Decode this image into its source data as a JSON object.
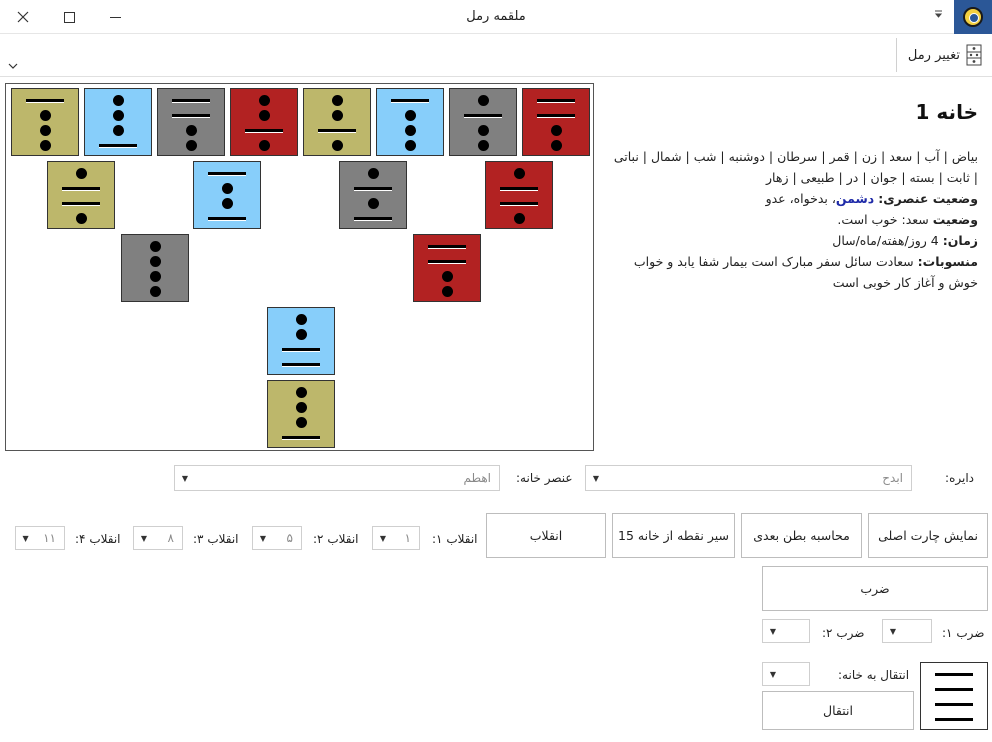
{
  "window": {
    "title": "ملقمه رمل",
    "app_icon": "seal-icon",
    "controls": {
      "minimize": "—",
      "maximize": "☐",
      "close": "✕"
    }
  },
  "ribbon": {
    "change_geomancy_label": "تغییر رمل",
    "change_icon": "dice-icon"
  },
  "colors": {
    "olive": "#bdb76b",
    "blue": "#87cefa",
    "gray": "#808080",
    "red": "#b22222",
    "enemy_text": "#1e2aa8"
  },
  "chart": {
    "top_row": [
      {
        "color": "olive",
        "lines": [
          2,
          1,
          1,
          1
        ]
      },
      {
        "color": "blue",
        "lines": [
          1,
          1,
          1,
          2
        ]
      },
      {
        "color": "gray",
        "lines": [
          2,
          2,
          1,
          1
        ]
      },
      {
        "color": "red",
        "lines": [
          1,
          1,
          2,
          1
        ]
      },
      {
        "color": "olive",
        "lines": [
          1,
          1,
          2,
          1
        ]
      },
      {
        "color": "blue",
        "lines": [
          2,
          1,
          1,
          1
        ]
      },
      {
        "color": "gray",
        "lines": [
          1,
          2,
          1,
          1
        ]
      },
      {
        "color": "red",
        "lines": [
          2,
          2,
          1,
          1
        ]
      }
    ],
    "second_row": [
      {
        "color": "olive",
        "lines": [
          1,
          2,
          2,
          1
        ]
      },
      {
        "color": "blue",
        "lines": [
          2,
          1,
          1,
          2
        ]
      },
      {
        "color": "gray",
        "lines": [
          1,
          2,
          1,
          2
        ]
      },
      {
        "color": "red",
        "lines": [
          1,
          2,
          2,
          1
        ]
      }
    ],
    "third_row": [
      {
        "color": "gray",
        "lines": [
          1,
          1,
          1,
          1
        ]
      },
      {
        "color": "red",
        "lines": [
          2,
          2,
          1,
          1
        ]
      }
    ],
    "judge": {
      "color": "blue",
      "lines": [
        1,
        1,
        2,
        2
      ]
    },
    "sentence": {
      "color": "olive",
      "lines": [
        1,
        1,
        1,
        2
      ]
    }
  },
  "info": {
    "title": "خانه 1",
    "attributes": "بیاض | آب | سعد | زن | قمر | سرطان | دوشنبه | شب | شمال | نباتی | ثابت | بسته | جوان | در | طبیعی | زهار",
    "elemental_label": "وضعیت عنصری:",
    "elemental_enemy": "دشمن",
    "elemental_rest": "، بدخواه، عدو",
    "status_label": "وضعیت",
    "status_value": "سعد: خوب است.",
    "time_label": "زمان:",
    "time_value": "4 روز/هفته/ماه/سال",
    "attribution_label": "منسوبات:",
    "attribution_value": "سعادت سائل سفر مبارک است بیمار شفا یابد و خواب خوش و آغاز کار خوبی است"
  },
  "form": {
    "circle_label": "دایره:",
    "circle_value": "ابدح",
    "element_label": "عنصر خانه:",
    "element_value": "اهطم",
    "show_main_chart": "نمایش چارت اصلی",
    "calc_inner": "محاسبه بطن بعدی",
    "dot_path": "سیر نقطه از خانه 15",
    "inqilab_button": "انقلاب",
    "inqilab1_label": "انقلاب ۱:",
    "inqilab1_value": "۱",
    "inqilab2_label": "انقلاب ۲:",
    "inqilab2_value": "۵",
    "inqilab3_label": "انقلاب ۳:",
    "inqilab3_value": "۸",
    "inqilab4_label": "انقلاب ۴:",
    "inqilab4_value": "۱۱",
    "multiply_button": "ضرب",
    "multiply1_label": "ضرب ۱:",
    "multiply1_value": "",
    "multiply2_label": "ضرب ۲:",
    "multiply2_value": "",
    "transfer_label": "انتقال به خانه:",
    "transfer_value": "",
    "transfer_button": "انتقال",
    "preview": {
      "lines": [
        2,
        2,
        2,
        2
      ]
    }
  }
}
